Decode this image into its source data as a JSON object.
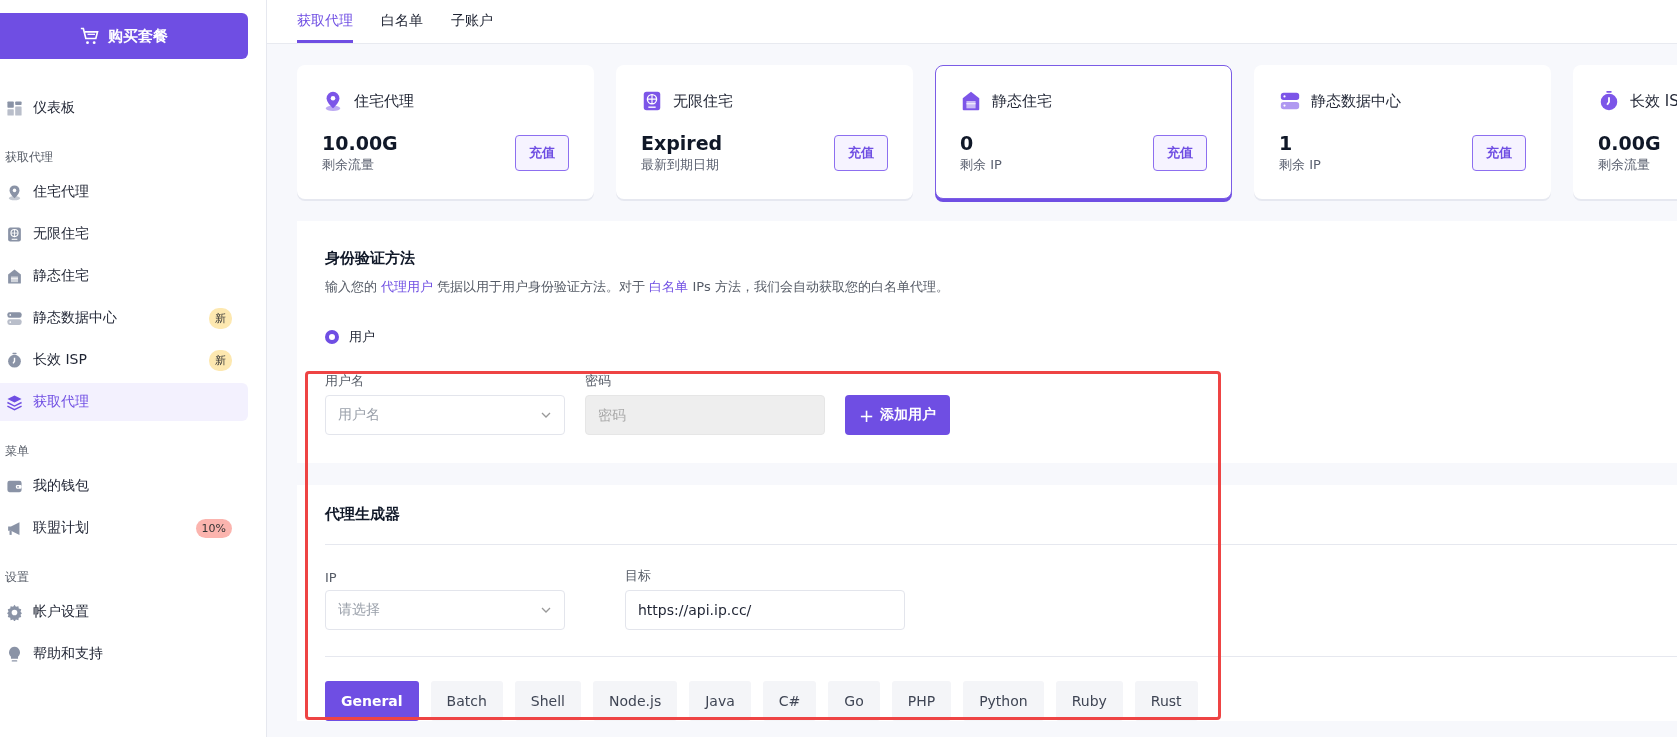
{
  "sidebar": {
    "buy_button": "购买套餐",
    "sections": [
      {
        "items": [
          {
            "label": "仪表板",
            "selected": false
          }
        ]
      },
      {
        "heading": "获取代理",
        "items": [
          {
            "label": "住宅代理",
            "selected": false
          },
          {
            "label": "无限住宅",
            "selected": false
          },
          {
            "label": "静态住宅",
            "selected": false
          },
          {
            "label": "静态数据中心",
            "selected": false,
            "badge": {
              "text": "新",
              "color": "#fde8b0"
            }
          },
          {
            "label": "长效 ISP",
            "selected": false,
            "badge": {
              "text": "新",
              "color": "#fde8b0"
            }
          },
          {
            "label": "获取代理",
            "selected": true
          }
        ]
      },
      {
        "heading": "菜单",
        "items": [
          {
            "label": "我的钱包",
            "selected": false
          },
          {
            "label": "联盟计划",
            "selected": false,
            "badge": {
              "text": "10%",
              "color": "#fbb4ae"
            }
          }
        ]
      },
      {
        "heading": "设置",
        "items": [
          {
            "label": "帐户设置",
            "selected": false
          },
          {
            "label": "帮助和支持",
            "selected": false
          }
        ]
      }
    ]
  },
  "tabs": [
    {
      "label": "获取代理",
      "selected": true
    },
    {
      "label": "白名单",
      "selected": false
    },
    {
      "label": "子账户",
      "selected": false
    }
  ],
  "cards": [
    {
      "title": "住宅代理",
      "value": "10.00G",
      "caption": "剩余流量",
      "button": "充值",
      "selected": false
    },
    {
      "title": "无限住宅",
      "value": "Expired",
      "caption": "最新到期日期",
      "button": "充值",
      "selected": false
    },
    {
      "title": "静态住宅",
      "value": "0",
      "caption": "剩余 IP",
      "button": "充值",
      "selected": true
    },
    {
      "title": "静态数据中心",
      "value": "1",
      "caption": "剩余 IP",
      "button": "充值",
      "selected": false
    },
    {
      "title": "长效 IS",
      "value": "0.00G",
      "caption": "剩余流量",
      "selected": false
    }
  ],
  "auth": {
    "title": "身份验证方法",
    "description": [
      {
        "text": "输入您的 "
      },
      {
        "text": "代理用户",
        "link": true
      },
      {
        "text": " 凭据以用于用户身份验证方法。对于 "
      },
      {
        "text": "白名单",
        "link": true
      },
      {
        "text": " IPs 方法，我们会自动获取您的白名单代理。"
      }
    ],
    "options": [
      {
        "label": "用户",
        "selected": true
      }
    ],
    "username": {
      "label": "用户名",
      "placeholder": "用户名"
    },
    "password": {
      "label": "密码",
      "placeholder": "密码",
      "disabled": true
    },
    "add_button": {
      "icon": "+",
      "label": "添加用户"
    }
  },
  "generator": {
    "title": "代理生成器",
    "ip": {
      "label": "IP",
      "placeholder": "请选择"
    },
    "target": {
      "label": "目标",
      "value": "https://api.ip.cc/"
    },
    "languages": [
      {
        "label": "General",
        "selected": true
      },
      {
        "label": "Batch",
        "selected": false
      },
      {
        "label": "Shell",
        "selected": false
      },
      {
        "label": "Node.js",
        "selected": false
      },
      {
        "label": "Java",
        "selected": false
      },
      {
        "label": "C#",
        "selected": false
      },
      {
        "label": "Go",
        "selected": false
      },
      {
        "label": "PHP",
        "selected": false
      },
      {
        "label": "Python",
        "selected": false
      },
      {
        "label": "Ruby",
        "selected": false
      },
      {
        "label": "Rust",
        "selected": false
      }
    ]
  },
  "annotation": {
    "kind": "rectangle"
  }
}
